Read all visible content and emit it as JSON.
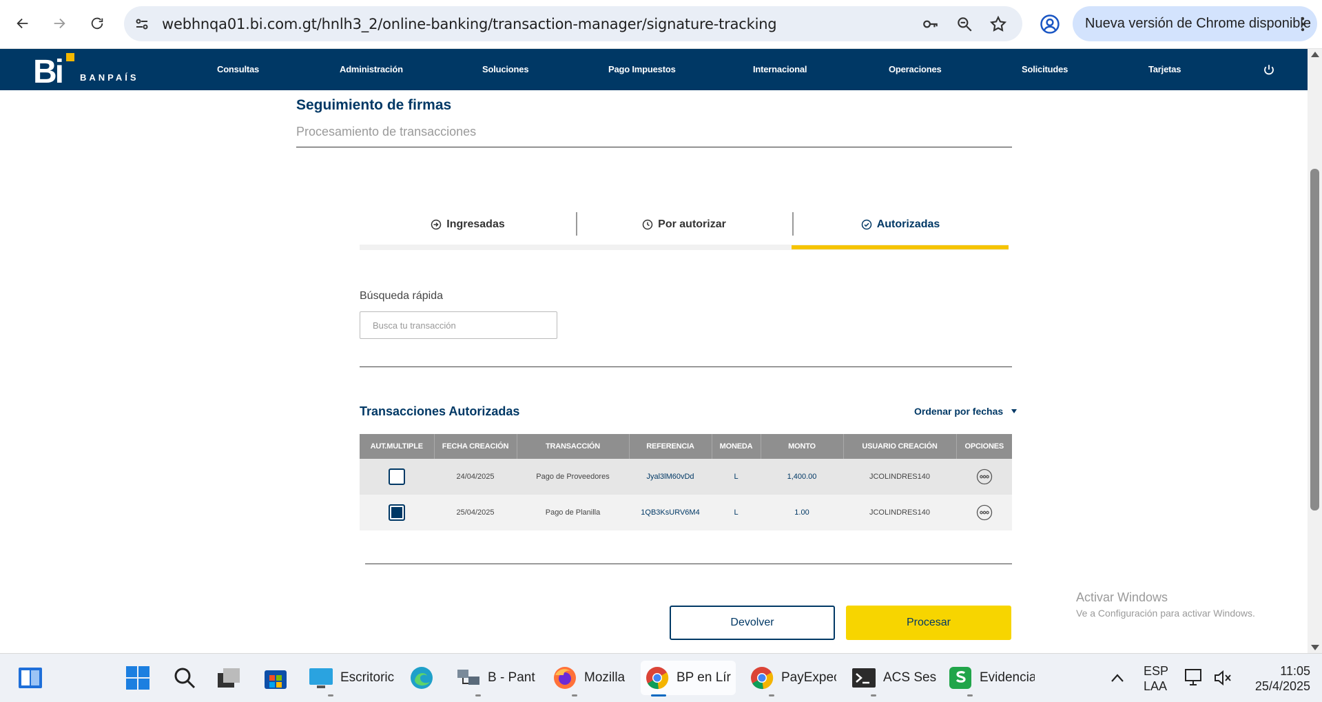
{
  "browser": {
    "url": "webhnqa01.bi.com.gt/hnlh3_2/online-banking/transaction-manager/signature-tracking",
    "update_label": "Nueva versión de Chrome disponible"
  },
  "header": {
    "logo_text": "BANPAÍS",
    "logo_mark": "Bi",
    "menu": [
      "Consultas",
      "Administración",
      "Soluciones",
      "Pago Impuestos",
      "Internacional",
      "Operaciones",
      "Solicitudes",
      "Tarjetas"
    ]
  },
  "page": {
    "title": "Seguimiento de firmas",
    "subtitle": "Procesamiento de transacciones"
  },
  "tabs": [
    {
      "label": "Ingresadas",
      "icon": "arrow-circle-icon",
      "active": false
    },
    {
      "label": "Por autorizar",
      "icon": "clock-icon",
      "active": false
    },
    {
      "label": "Autorizadas",
      "icon": "check-circle-icon",
      "active": true
    }
  ],
  "search": {
    "label": "Búsqueda rápida",
    "placeholder": "Busca tu transacción",
    "value": ""
  },
  "section": {
    "title": "Transacciones Autorizadas",
    "sort_label": "Ordenar por fechas"
  },
  "table": {
    "headers": [
      "AUT.MULTIPLE",
      "FECHA CREACIÓN",
      "TRANSACCIÓN",
      "REFERENCIA",
      "MONEDA",
      "MONTO",
      "USUARIO CREACIÓN",
      "OPCIONES"
    ],
    "rows": [
      {
        "checked": false,
        "date": "24/04/2025",
        "transaction": "Pago de Proveedores",
        "reference": "Jyal3lM60vDd",
        "currency": "L",
        "amount": "1,400.00",
        "user": "JCOLINDRES140"
      },
      {
        "checked": true,
        "date": "25/04/2025",
        "transaction": "Pago de Planilla",
        "reference": "1QB3KsURV6M4",
        "currency": "L",
        "amount": "1.00",
        "user": "JCOLINDRES140"
      }
    ]
  },
  "actions": {
    "return_label": "Devolver",
    "process_label": "Procesar"
  },
  "watermark": {
    "line1": "Activar Windows",
    "line2": "Ve a Configuración para activar Windows."
  },
  "taskbar": {
    "items": [
      {
        "label": "Escritoric",
        "icon": "desktop-icon"
      },
      {
        "label": "B - Pant",
        "icon": "remote-desktop-icon"
      },
      {
        "label": "Mozilla",
        "icon": "firefox-icon"
      },
      {
        "label": "BP en Lír",
        "icon": "chrome-icon"
      },
      {
        "label": "PayExpec",
        "icon": "chrome-icon"
      },
      {
        "label": "ACS Ses",
        "icon": "terminal-icon"
      },
      {
        "label": "Evidencia",
        "icon": "spreadsheet-icon"
      }
    ],
    "language_top": "ESP",
    "language_bottom": "LAA",
    "time": "11:05",
    "date": "25/4/2025"
  },
  "colors": {
    "brand_navy": "#003865",
    "accent_yellow": "#f6c400",
    "logo_dot": "#f5b800"
  }
}
